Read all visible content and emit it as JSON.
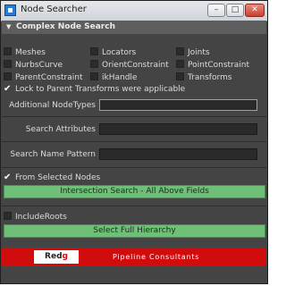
{
  "window": {
    "title": "Node Searcher",
    "min_label": "–",
    "max_label": "□",
    "close_label": "✕"
  },
  "section": {
    "title": "Complex Node Search"
  },
  "node_types": {
    "col1": [
      "Meshes",
      "NurbsCurve",
      "ParentConstraint"
    ],
    "col2": [
      "Locators",
      "OrientConstraint",
      "ikHandle"
    ],
    "col3": [
      "Joints",
      "PointConstraint",
      "Transforms"
    ]
  },
  "lock_parent": {
    "label": "Lock to Parent Transforms were applicable",
    "checked": true
  },
  "fields": {
    "additional_node_types": {
      "label": "Additional NodeTypes",
      "value": ""
    },
    "search_attributes": {
      "label": "Search Attributes",
      "value": ""
    },
    "search_name_pattern": {
      "label": "Search Name Pattern",
      "value": ""
    }
  },
  "from_selected": {
    "label": "From Selected Nodes",
    "checked": true
  },
  "intersection_button": {
    "label": "Intersection Search - All Above Fields"
  },
  "include_roots": {
    "label": "IncludeRoots",
    "checked": false
  },
  "full_hierarchy_button": {
    "label": "Select Full Hierarchy"
  },
  "banner": {
    "logo_main": "Red",
    "logo_accent": "g",
    "tagline": "Pipeline Consultants"
  },
  "colors": {
    "accent_green": "#6fbf78",
    "banner_red": "#d10c0c"
  }
}
